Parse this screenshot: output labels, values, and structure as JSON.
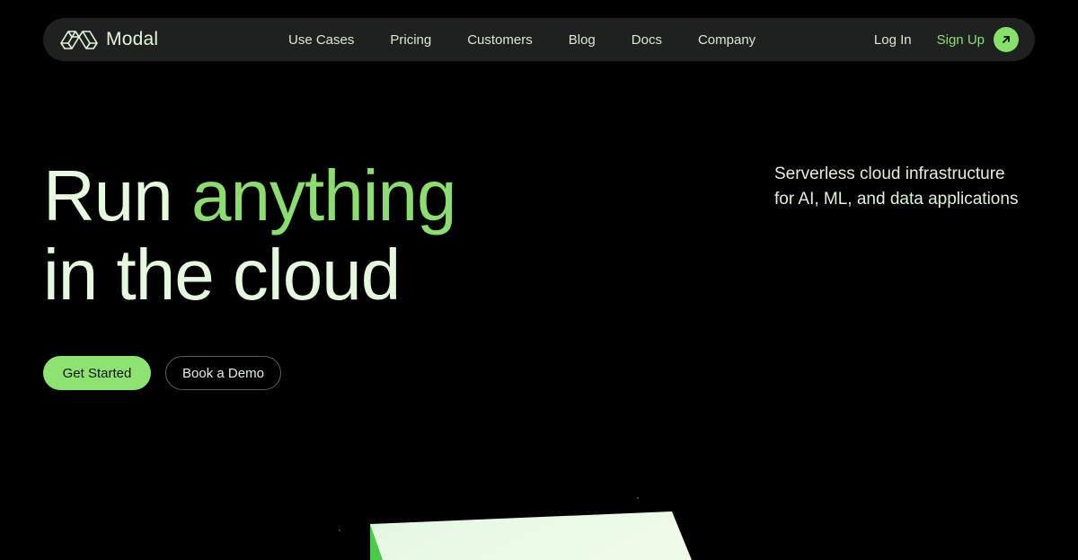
{
  "brand": {
    "name": "Modal",
    "logo_icon": "modal-logo-icon"
  },
  "nav": {
    "links": [
      {
        "label": "Use Cases"
      },
      {
        "label": "Pricing"
      },
      {
        "label": "Customers"
      },
      {
        "label": "Blog"
      },
      {
        "label": "Docs"
      },
      {
        "label": "Company"
      }
    ],
    "login_label": "Log In",
    "signup_label": "Sign Up",
    "signup_icon": "arrow-up-right-icon"
  },
  "hero": {
    "headline_part1": "Run ",
    "headline_accent": "anything",
    "headline_part2": "in the cloud",
    "tagline_line1": "Serverless cloud infrastructure",
    "tagline_line2": "for AI, ML, and data applications",
    "primary_cta": "Get Started",
    "secondary_cta": "Book a Demo"
  },
  "colors": {
    "accent": "#8ee272",
    "background": "#000000",
    "nav_bg": "#1f2120",
    "text": "#e6f9e0"
  }
}
